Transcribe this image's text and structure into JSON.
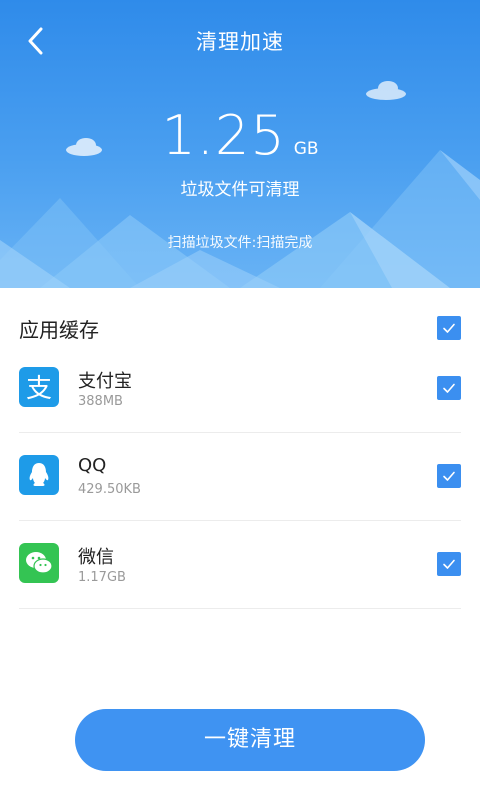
{
  "header": {
    "title": "清理加速",
    "junk_size": "1.25",
    "junk_unit": "GB",
    "subtitle": "垃圾文件可清理",
    "scan_status": "扫描垃圾文件:扫描完成"
  },
  "section": {
    "title": "应用缓存",
    "all_checked": true
  },
  "apps": [
    {
      "name": "支付宝",
      "size": "388MB",
      "icon": "alipay-icon",
      "checked": true
    },
    {
      "name": "QQ",
      "size": "429.50KB",
      "icon": "qq-icon",
      "checked": true
    },
    {
      "name": "微信",
      "size": "1.17GB",
      "icon": "wechat-icon",
      "checked": true
    }
  ],
  "action": {
    "label": "一键清理"
  },
  "colors": {
    "accent": "#3f93f2",
    "alipay": "#1e9be8",
    "qq": "#1e9be8",
    "wechat": "#34c453"
  }
}
